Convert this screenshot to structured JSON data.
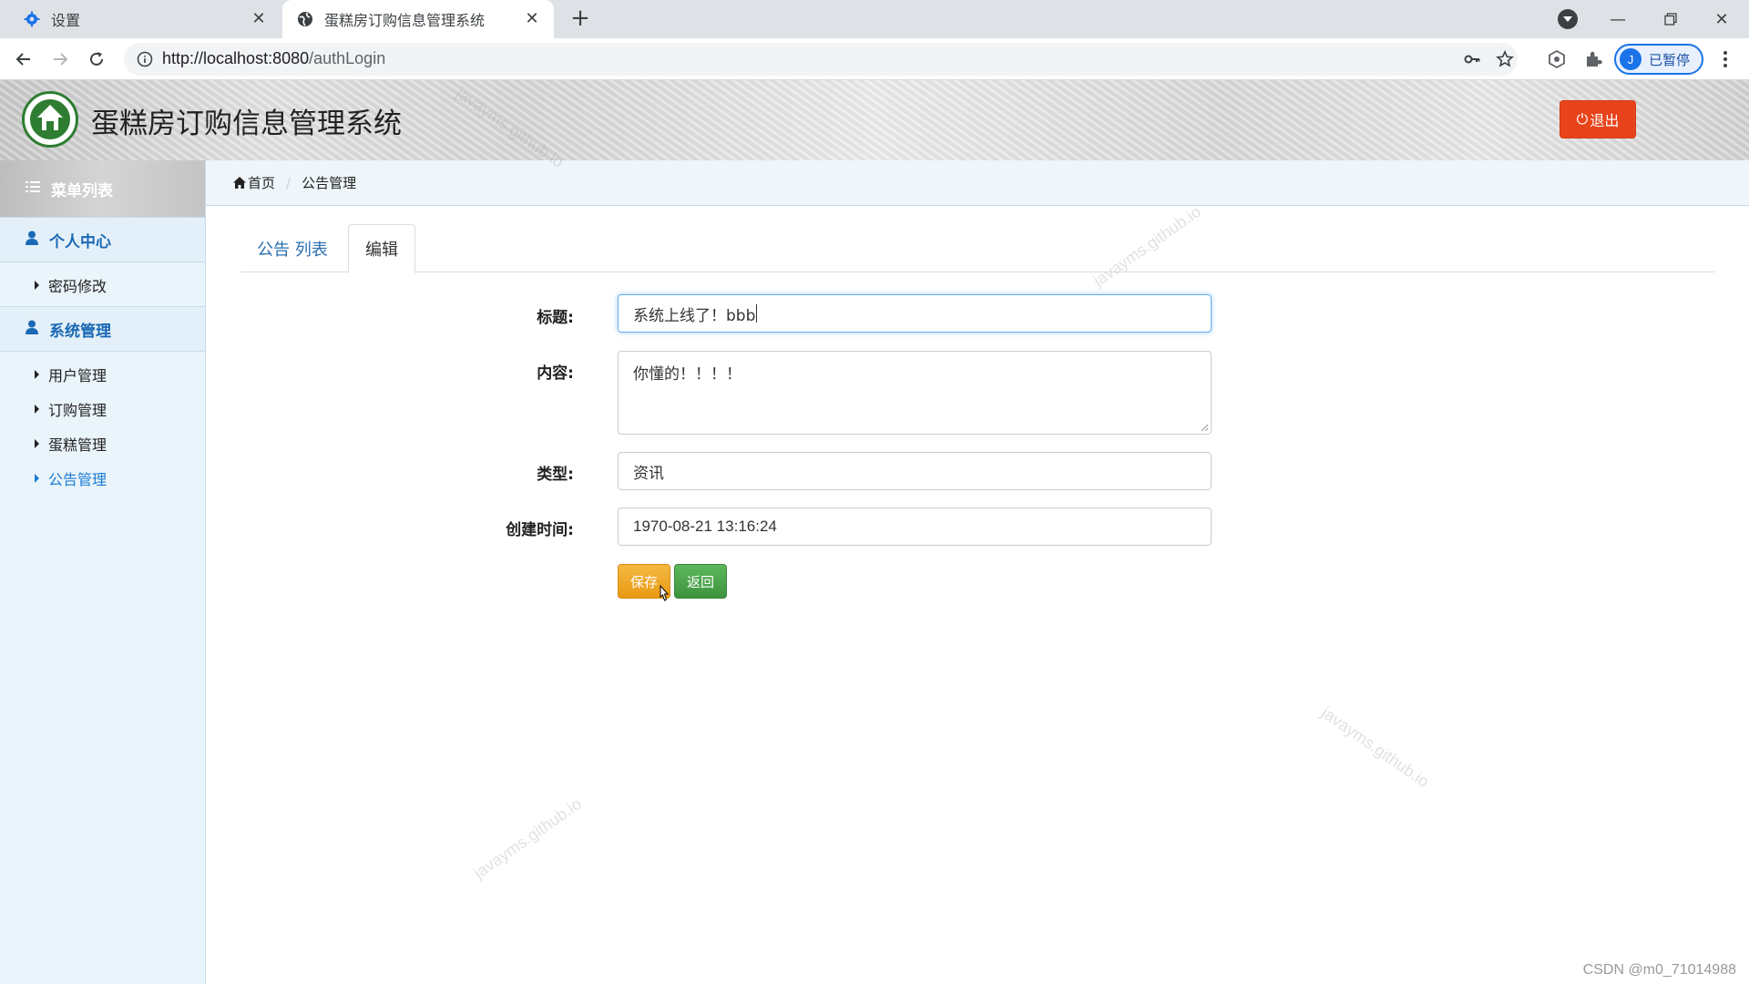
{
  "browser": {
    "tabs": [
      {
        "title": "设置"
      },
      {
        "title": "蛋糕房订购信息管理系统"
      }
    ],
    "url_host": "http://localhost:8080",
    "url_path": "/authLogin",
    "profile_initial": "J",
    "profile_label": "已暂停"
  },
  "header": {
    "title": "蛋糕房订购信息管理系统",
    "logout_label": "退出"
  },
  "sidebar": {
    "menu_title": "菜单列表",
    "groups": [
      {
        "label": "个人中心",
        "items": [
          {
            "label": "密码修改"
          }
        ]
      },
      {
        "label": "系统管理",
        "items": [
          {
            "label": "用户管理"
          },
          {
            "label": "订购管理"
          },
          {
            "label": "蛋糕管理"
          },
          {
            "label": "公告管理"
          }
        ]
      }
    ]
  },
  "breadcrumb": {
    "home": "首页",
    "current": "公告管理"
  },
  "tabs": [
    {
      "label": "公告 列表"
    },
    {
      "label": "编辑"
    }
  ],
  "form": {
    "title_label": "标题:",
    "title_value": "系统上线了！bbb",
    "content_label": "内容:",
    "content_value": "你懂的！！！！",
    "type_label": "类型:",
    "type_value": "资讯",
    "time_label": "创建时间:",
    "time_value": "1970-08-21 13:16:24",
    "save_label": "保存",
    "back_label": "返回"
  },
  "watermark": "javayms.github.io",
  "footer_credit": "CSDN @m0_71014988",
  "colors": {
    "logout": "#e8431a",
    "save": "#f0ad4e",
    "back": "#5cb85c",
    "menu_accent": "#1a69b4"
  }
}
